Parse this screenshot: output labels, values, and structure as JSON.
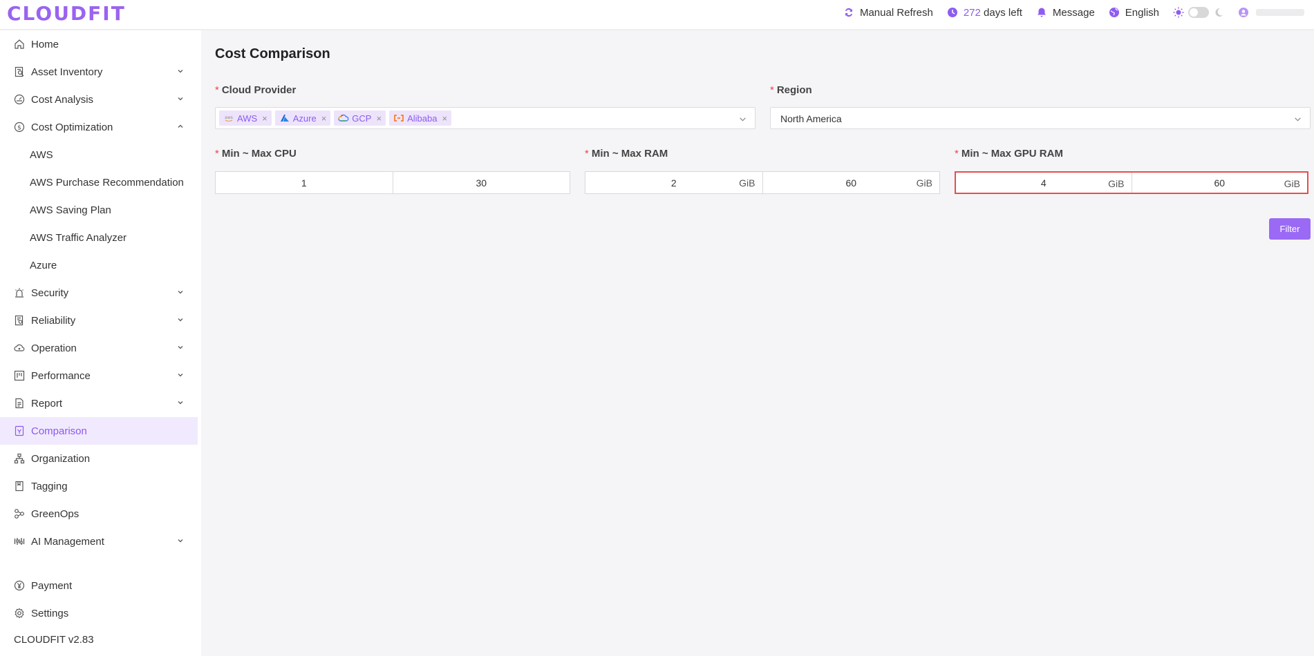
{
  "app": {
    "logo": "CLOUDFIT"
  },
  "header": {
    "manual_refresh": "Manual Refresh",
    "days_count": "272",
    "days_label": "days left",
    "message": "Message",
    "language": "English"
  },
  "sidebar": {
    "items": [
      {
        "label": "Home",
        "icon": "home-icon"
      },
      {
        "label": "Asset Inventory",
        "icon": "inventory-icon"
      },
      {
        "label": "Cost Analysis",
        "icon": "gauge-icon"
      },
      {
        "label": "Cost Optimization",
        "icon": "dollar-icon"
      },
      {
        "label": "AWS"
      },
      {
        "label": "AWS Purchase Recommendation"
      },
      {
        "label": "AWS Saving Plan"
      },
      {
        "label": "AWS Traffic Analyzer"
      },
      {
        "label": "Azure"
      },
      {
        "label": "Security",
        "icon": "alarm-icon"
      },
      {
        "label": "Reliability",
        "icon": "reliability-icon"
      },
      {
        "label": "Operation",
        "icon": "cloud-icon"
      },
      {
        "label": "Performance",
        "icon": "performance-icon"
      },
      {
        "label": "Report",
        "icon": "report-icon"
      },
      {
        "label": "Comparison",
        "icon": "comparison-icon"
      },
      {
        "label": "Organization",
        "icon": "organization-icon"
      },
      {
        "label": "Tagging",
        "icon": "bookmark-icon"
      },
      {
        "label": "GreenOps",
        "icon": "greenops-icon"
      },
      {
        "label": "AI Management",
        "icon": "ai-icon"
      },
      {
        "label": "Payment",
        "icon": "yen-icon"
      },
      {
        "label": "Settings",
        "icon": "gear-icon"
      }
    ],
    "version": "CLOUDFIT v2.83"
  },
  "main": {
    "title": "Cost Comparison",
    "cloud_provider": {
      "label": "Cloud Provider",
      "tags": [
        "AWS",
        "Azure",
        "GCP",
        "Alibaba"
      ]
    },
    "region": {
      "label": "Region",
      "value": "North America"
    },
    "cpu": {
      "label": "Min ~ Max CPU",
      "min": "1",
      "max": "30"
    },
    "ram": {
      "label": "Min ~ Max RAM",
      "min": "2",
      "max": "60",
      "unit": "GiB"
    },
    "gpu_ram": {
      "label": "Min ~ Max GPU RAM",
      "min": "4",
      "max": "60",
      "unit": "GiB"
    },
    "filter_button": "Filter"
  },
  "colors": {
    "accent": "#9a6af5",
    "error": "#e84c4c",
    "active_bg": "#f1eafe"
  }
}
